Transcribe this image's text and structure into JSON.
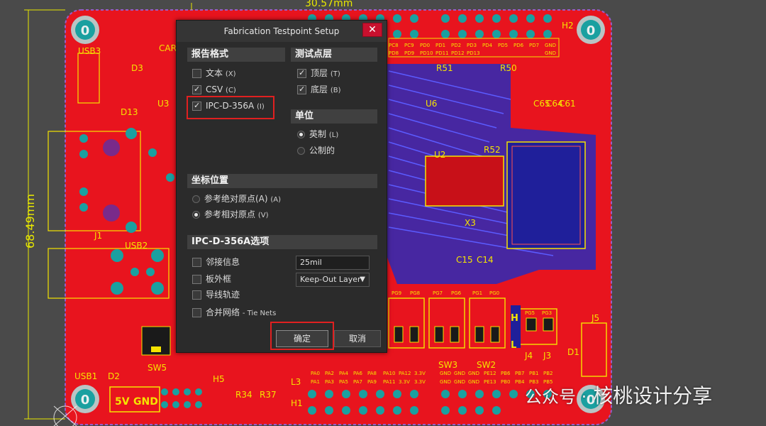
{
  "dialog": {
    "title": "Fabrication Testpoint Setup",
    "close_glyph": "✕",
    "report_format": {
      "header": "报告格式",
      "items": [
        {
          "label": "文本",
          "hotkey": "(X)",
          "checked": false
        },
        {
          "label": "CSV",
          "hotkey": "(C)",
          "checked": true
        },
        {
          "label": "IPC-D-356A",
          "hotkey": "(I)",
          "checked": true
        }
      ]
    },
    "testpoint_layer": {
      "header": "测试点层",
      "items": [
        {
          "label": "顶层",
          "hotkey": "(T)",
          "checked": true
        },
        {
          "label": "底层",
          "hotkey": "(B)",
          "checked": true
        }
      ]
    },
    "units": {
      "header": "单位",
      "items": [
        {
          "label": "英制",
          "hotkey": "(L)",
          "selected": true
        },
        {
          "label": "公制的",
          "hotkey": "",
          "selected": false
        }
      ]
    },
    "coordinates": {
      "header": "坐标位置",
      "items": [
        {
          "label": "参考绝对原点(A)",
          "hotkey": "(A)",
          "selected": false
        },
        {
          "label": "参考相对原点",
          "hotkey": "(V)",
          "selected": true
        }
      ]
    },
    "ipc_options": {
      "header": "IPC-D-356A选项",
      "items": [
        {
          "label": "邻接信息",
          "checked": false
        },
        {
          "label": "板外框",
          "checked": false
        },
        {
          "label": "导线轨迹",
          "checked": false
        },
        {
          "label": "合并网络",
          "suffix": "- Tie Nets",
          "checked": false
        }
      ],
      "adjacency_value": "25mil",
      "outline_layer": "Keep-Out Layer"
    },
    "ok_label": "确定",
    "cancel_label": "取消"
  },
  "pcb": {
    "dimension_width": "30.57mm",
    "dimension_height": "68.49mm",
    "hole_label": "0",
    "silk_labels": [
      "USB3",
      "D3",
      "D13",
      "U3",
      "J1",
      "USB2",
      "USB1",
      "D2",
      "SW5",
      "H5",
      "R34",
      "R37",
      "L3",
      "H1",
      "R51",
      "R50",
      "C65",
      "C64",
      "C61",
      "U6",
      "U2",
      "R52",
      "X3",
      "C15",
      "C14",
      "J5",
      "D1",
      "J4",
      "J3",
      "SW3",
      "SW2",
      "H2",
      "CAR",
      "5V",
      "GND",
      "H",
      "L"
    ],
    "pin_labels_top": [
      "PC8",
      "PC9",
      "PD0",
      "PD1",
      "PD2",
      "PD3",
      "PD4",
      "PD5",
      "PD6",
      "PD7",
      "PD8",
      "PD9",
      "PD10",
      "PD11",
      "PD12",
      "PD13",
      "GND",
      "GND"
    ],
    "pin_labels_mid": [
      "PG9",
      "PG8",
      "PG7",
      "PG6",
      "PG1",
      "PG0",
      "PG5",
      "PG3"
    ],
    "pin_labels_bottom_a": [
      "PA0",
      "PA2",
      "PA4",
      "PA6",
      "PA8",
      "PA10",
      "PA12",
      "3.3V"
    ],
    "pin_labels_bottom_b": [
      "PA1",
      "PA3",
      "PA5",
      "PA7",
      "PA9",
      "PA11",
      "3.3V",
      "3.3V"
    ],
    "pin_labels_bottom_c": [
      "GND",
      "GND",
      "GND",
      "PE12",
      "PB6",
      "PB7",
      "PB1",
      "PB2"
    ],
    "pin_labels_bottom_d": [
      "GND",
      "GND",
      "GND",
      "PE13",
      "PB0",
      "PB4",
      "PB3",
      "PB5"
    ]
  },
  "watermark": {
    "prefix": "公众号 ·",
    "name": "核桃设计分享"
  },
  "colors": {
    "board": "#e8141e",
    "copper_blue": "#2a2ab8",
    "silk": "#f5e400",
    "dialog_bg": "#2b2b2b",
    "highlight": "#e02020"
  }
}
